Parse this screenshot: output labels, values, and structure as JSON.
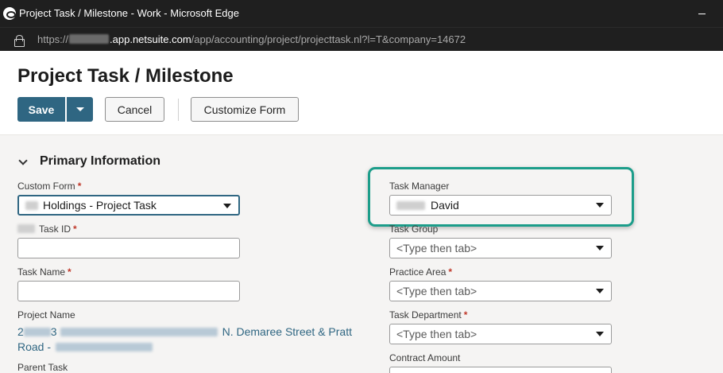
{
  "window": {
    "title": "Project Task / Milestone - Work - Microsoft Edge"
  },
  "address": {
    "prefix": "https://",
    "host": ".app.netsuite.com",
    "path": "/app/accounting/project/projecttask.nl?l=T&company=14672"
  },
  "page": {
    "title": "Project Task / Milestone"
  },
  "toolbar": {
    "save_label": "Save",
    "cancel_label": "Cancel",
    "customize_label": "Customize Form"
  },
  "section": {
    "title": "Primary Information"
  },
  "fields": {
    "custom_form": {
      "label": "Custom Form",
      "value": "Holdings - Project Task"
    },
    "task_id": {
      "label": "Task ID",
      "value": ""
    },
    "task_name": {
      "label": "Task Name",
      "value": ""
    },
    "project_name": {
      "label": "Project Name",
      "value_start": "2",
      "value_mid": "3",
      "value_line1": "N. Demaree Street & Pratt",
      "value_line2": "Road -"
    },
    "parent_task": {
      "label": "Parent Task"
    },
    "task_manager": {
      "label": "Task Manager",
      "value": "David"
    },
    "task_group": {
      "label": "Task Group",
      "placeholder": "<Type then tab>"
    },
    "practice_area": {
      "label": "Practice Area",
      "placeholder": "<Type then tab>"
    },
    "task_department": {
      "label": "Task Department",
      "placeholder": "<Type then tab>"
    },
    "contract_amount": {
      "label": "Contract Amount"
    }
  },
  "required_mark": "*",
  "colors": {
    "primary_button": "#2f6682",
    "highlight": "#1c9d8a",
    "required": "#c0392b"
  }
}
